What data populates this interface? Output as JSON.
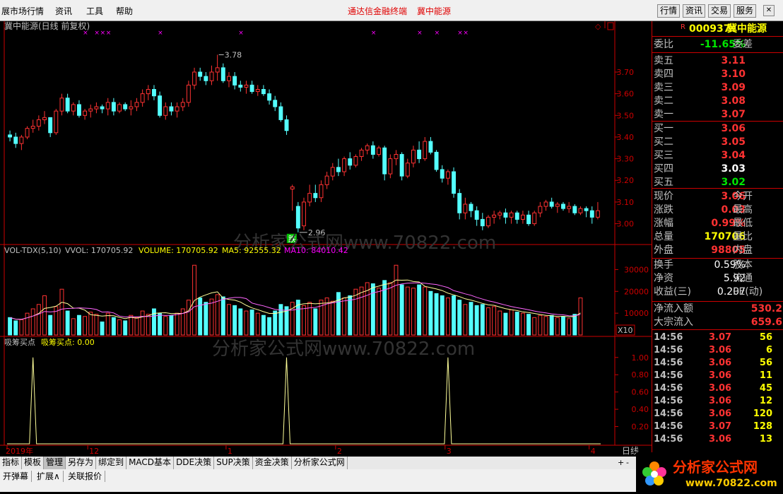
{
  "menubar": {
    "items": [
      "展市场行情",
      "资讯",
      "工具",
      "帮助"
    ],
    "center_left": "通达信金融终端",
    "center_right": "冀中能源",
    "right_buttons": [
      "行情",
      "资讯",
      "交易",
      "服务"
    ]
  },
  "chart_title": "冀中能源(日线 前复权)",
  "labels": {
    "high": "3.78",
    "low": "2.96",
    "die": "跌",
    "x10": "X10",
    "period": "日线"
  },
  "watermark": "分析家公式网www.70822.com",
  "vol_header": {
    "name": "VOL-TDX(5,10)",
    "vvol": "VVOL: 170705.92",
    "volume": "VOLUME: 170705.92",
    "ma5": "MA5: 92555.32",
    "ma10": "MA10: 84010.42"
  },
  "ind_header": {
    "name": "吸筹买点",
    "value": "吸筹买点: 0.00"
  },
  "x_axis": [
    "2019年",
    "12",
    "1",
    "2",
    "3",
    "4"
  ],
  "chart_data": [
    {
      "type": "candlestick",
      "title": "冀中能源(日线 前复权)",
      "ylim": [
        2.93,
        3.85
      ],
      "yticks": [
        3.0,
        3.1,
        3.2,
        3.3,
        3.4,
        3.5,
        3.6,
        3.7
      ],
      "ohlc": [
        [
          3.41,
          3.43,
          3.38,
          3.4
        ],
        [
          3.4,
          3.42,
          3.35,
          3.37
        ],
        [
          3.37,
          3.41,
          3.34,
          3.4
        ],
        [
          3.4,
          3.45,
          3.39,
          3.44
        ],
        [
          3.44,
          3.48,
          3.42,
          3.45
        ],
        [
          3.45,
          3.5,
          3.43,
          3.48
        ],
        [
          3.48,
          3.52,
          3.46,
          3.49
        ],
        [
          3.49,
          3.48,
          3.4,
          3.42
        ],
        [
          3.42,
          3.53,
          3.41,
          3.52
        ],
        [
          3.52,
          3.6,
          3.5,
          3.58
        ],
        [
          3.58,
          3.6,
          3.51,
          3.52
        ],
        [
          3.52,
          3.56,
          3.5,
          3.55
        ],
        [
          3.55,
          3.57,
          3.49,
          3.5
        ],
        [
          3.5,
          3.53,
          3.48,
          3.52
        ],
        [
          3.52,
          3.55,
          3.49,
          3.53
        ],
        [
          3.53,
          3.56,
          3.51,
          3.54
        ],
        [
          3.54,
          3.55,
          3.51,
          3.53
        ],
        [
          3.53,
          3.58,
          3.5,
          3.56
        ],
        [
          3.56,
          3.58,
          3.5,
          3.52
        ],
        [
          3.52,
          3.56,
          3.51,
          3.55
        ],
        [
          3.55,
          3.56,
          3.52,
          3.53
        ],
        [
          3.53,
          3.57,
          3.5,
          3.54
        ],
        [
          3.54,
          3.58,
          3.52,
          3.56
        ],
        [
          3.56,
          3.62,
          3.54,
          3.6
        ],
        [
          3.6,
          3.64,
          3.57,
          3.62
        ],
        [
          3.62,
          3.64,
          3.57,
          3.59
        ],
        [
          3.59,
          3.61,
          3.49,
          3.5
        ],
        [
          3.5,
          3.56,
          3.48,
          3.54
        ],
        [
          3.54,
          3.56,
          3.5,
          3.52
        ],
        [
          3.52,
          3.56,
          3.49,
          3.54
        ],
        [
          3.54,
          3.58,
          3.52,
          3.56
        ],
        [
          3.56,
          3.66,
          3.54,
          3.64
        ],
        [
          3.64,
          3.72,
          3.62,
          3.7
        ],
        [
          3.7,
          3.72,
          3.66,
          3.68
        ],
        [
          3.68,
          3.7,
          3.64,
          3.66
        ],
        [
          3.66,
          3.73,
          3.64,
          3.7
        ],
        [
          3.7,
          3.78,
          3.66,
          3.72
        ],
        [
          3.72,
          3.74,
          3.65,
          3.66
        ],
        [
          3.66,
          3.7,
          3.63,
          3.68
        ],
        [
          3.68,
          3.7,
          3.62,
          3.64
        ],
        [
          3.64,
          3.66,
          3.61,
          3.63
        ],
        [
          3.63,
          3.66,
          3.6,
          3.64
        ],
        [
          3.64,
          3.66,
          3.6,
          3.61
        ],
        [
          3.61,
          3.64,
          3.59,
          3.62
        ],
        [
          3.62,
          3.64,
          3.59,
          3.6
        ],
        [
          3.6,
          3.62,
          3.55,
          3.57
        ],
        [
          3.57,
          3.59,
          3.52,
          3.54
        ],
        [
          3.54,
          3.56,
          3.47,
          3.48
        ],
        [
          3.48,
          3.5,
          3.41,
          3.43
        ],
        [
          3.16,
          3.18,
          3.06,
          3.17
        ],
        [
          3.08,
          3.1,
          2.96,
          2.98
        ],
        [
          2.99,
          3.12,
          2.97,
          3.1
        ],
        [
          3.1,
          3.18,
          3.08,
          3.14
        ],
        [
          3.14,
          3.18,
          3.1,
          3.12
        ],
        [
          3.12,
          3.2,
          3.1,
          3.18
        ],
        [
          3.18,
          3.24,
          3.16,
          3.22
        ],
        [
          3.22,
          3.28,
          3.2,
          3.26
        ],
        [
          3.26,
          3.3,
          3.22,
          3.24
        ],
        [
          3.24,
          3.31,
          3.22,
          3.3
        ],
        [
          3.3,
          3.33,
          3.25,
          3.27
        ],
        [
          3.27,
          3.32,
          3.26,
          3.31
        ],
        [
          3.31,
          3.35,
          3.29,
          3.34
        ],
        [
          3.34,
          3.37,
          3.32,
          3.36
        ],
        [
          3.36,
          3.38,
          3.3,
          3.32
        ],
        [
          3.32,
          3.36,
          3.31,
          3.35
        ],
        [
          3.35,
          3.36,
          3.2,
          3.23
        ],
        [
          3.23,
          3.32,
          3.21,
          3.3
        ],
        [
          3.3,
          3.34,
          3.27,
          3.32
        ],
        [
          3.32,
          3.33,
          3.2,
          3.22
        ],
        [
          3.22,
          3.3,
          3.21,
          3.28
        ],
        [
          3.28,
          3.36,
          3.26,
          3.34
        ],
        [
          3.34,
          3.38,
          3.28,
          3.3
        ],
        [
          3.3,
          3.4,
          3.29,
          3.38
        ],
        [
          3.38,
          3.4,
          3.32,
          3.33
        ],
        [
          3.33,
          3.34,
          3.24,
          3.25
        ],
        [
          3.25,
          3.27,
          3.19,
          3.21
        ],
        [
          3.21,
          3.25,
          3.18,
          3.24
        ],
        [
          3.24,
          3.26,
          3.12,
          3.14
        ],
        [
          3.14,
          3.16,
          3.02,
          3.05
        ],
        [
          3.05,
          3.12,
          3.02,
          3.09
        ],
        [
          3.09,
          3.1,
          3.03,
          3.06
        ],
        [
          3.06,
          3.08,
          2.99,
          3.02
        ],
        [
          3.02,
          3.05,
          2.97,
          2.99
        ],
        [
          2.99,
          3.04,
          2.98,
          3.03
        ],
        [
          3.03,
          3.06,
          3.0,
          3.04
        ],
        [
          3.04,
          3.06,
          3.02,
          3.05
        ],
        [
          3.05,
          3.07,
          3.0,
          3.03
        ],
        [
          3.03,
          3.06,
          3.0,
          3.05
        ],
        [
          3.05,
          3.06,
          3.0,
          3.02
        ],
        [
          3.02,
          3.06,
          3.0,
          3.04
        ],
        [
          3.04,
          3.06,
          2.99,
          3.0
        ],
        [
          3.0,
          3.06,
          2.99,
          3.05
        ],
        [
          3.05,
          3.1,
          3.03,
          3.08
        ],
        [
          3.08,
          3.11,
          3.06,
          3.1
        ],
        [
          3.1,
          3.12,
          3.07,
          3.08
        ],
        [
          3.08,
          3.1,
          3.05,
          3.09
        ],
        [
          3.09,
          3.1,
          3.06,
          3.07
        ],
        [
          3.07,
          3.1,
          3.05,
          3.08
        ],
        [
          3.08,
          3.09,
          3.04,
          3.05
        ],
        [
          3.05,
          3.08,
          3.04,
          3.07
        ],
        [
          3.07,
          3.08,
          3.03,
          3.06
        ],
        [
          3.06,
          3.08,
          3.0,
          3.03
        ],
        [
          3.03,
          3.1,
          3.02,
          3.06
        ]
      ]
    },
    {
      "type": "bar",
      "title": "VOL-TDX(5,10)",
      "ylim": [
        0,
        35000
      ],
      "yticks": [
        10000,
        20000,
        30000
      ],
      "values": [
        8000,
        6500,
        7000,
        10000,
        12000,
        14000,
        18000,
        9000,
        13000,
        21000,
        11000,
        7500,
        9000,
        8500,
        10500,
        9500,
        6000,
        10000,
        8000,
        7000,
        6500,
        9000,
        8000,
        11000,
        9500,
        12000,
        10000,
        8500,
        9000,
        10000,
        12000,
        16000,
        32000,
        17000,
        15000,
        16500,
        18500,
        17500,
        14000,
        13500,
        12000,
        11000,
        11500,
        10000,
        9000,
        8000,
        11000,
        14000,
        13000,
        15000,
        16000,
        13500,
        15000,
        12000,
        16000,
        17000,
        15500,
        19500,
        17000,
        18000,
        21000,
        22000,
        24000,
        23500,
        21500,
        25000,
        24000,
        32000,
        23000,
        22000,
        21500,
        23000,
        22000,
        20000,
        19000,
        18000,
        17000,
        18000,
        16000,
        14000,
        15000,
        13500,
        14000,
        12500,
        13000,
        11000,
        10000,
        11500,
        10500,
        10000,
        9500,
        8000,
        9000,
        8500,
        9000,
        8000,
        8500,
        7500,
        9500,
        17000
      ],
      "series": [
        {
          "name": "MA5",
          "values": "smooth"
        },
        {
          "name": "MA10",
          "values": "smooth"
        }
      ]
    },
    {
      "type": "line",
      "title": "吸筹买点",
      "ylim": [
        0,
        1.08
      ],
      "yticks": [
        0.2,
        0.4,
        0.6,
        0.8,
        1.0
      ],
      "values": "0 except peaks of 1.00 at bars 4, 48, 76"
    }
  ],
  "quote": {
    "code": "000937",
    "name": "冀中能源",
    "weibi": {
      "label": "委比",
      "value": "-11.65%",
      "label2": "委差"
    },
    "sell": [
      {
        "label": "卖五",
        "price": "3.11"
      },
      {
        "label": "卖四",
        "price": "3.10"
      },
      {
        "label": "卖三",
        "price": "3.09"
      },
      {
        "label": "卖二",
        "price": "3.08"
      },
      {
        "label": "卖一",
        "price": "3.07"
      }
    ],
    "buy": [
      {
        "label": "买一",
        "price": "3.06"
      },
      {
        "label": "买二",
        "price": "3.05"
      },
      {
        "label": "买三",
        "price": "3.04"
      },
      {
        "label": "买四",
        "price": "3.03"
      },
      {
        "label": "买五",
        "price": "3.02"
      }
    ],
    "stats": [
      {
        "l": "现价",
        "v": "3.06",
        "r": "今开"
      },
      {
        "l": "涨跌",
        "v": "0.03",
        "r": "最高"
      },
      {
        "l": "涨幅",
        "v": "0.99%",
        "r": "最低"
      },
      {
        "l": "总量",
        "v": "170706",
        "r": "量比"
      },
      {
        "l": "外盘",
        "v": "98805",
        "r": "内盘"
      }
    ],
    "stats2": [
      {
        "l": "换手",
        "v": "0.59%",
        "r": "股本"
      },
      {
        "l": "净资",
        "v": "5.92",
        "r": "流通"
      },
      {
        "l": "收益(三)",
        "v": "0.207",
        "r": "PE(动)"
      }
    ],
    "flow": [
      {
        "l": "净流入额",
        "v": "530.2"
      },
      {
        "l": "大宗流入",
        "v": "659.6"
      }
    ],
    "ticks": [
      {
        "t": "14:56",
        "p": "3.07",
        "v": "56"
      },
      {
        "t": "14:56",
        "p": "3.06",
        "v": "6"
      },
      {
        "t": "14:56",
        "p": "3.06",
        "v": "56"
      },
      {
        "t": "14:56",
        "p": "3.06",
        "v": "11"
      },
      {
        "t": "14:56",
        "p": "3.06",
        "v": "45"
      },
      {
        "t": "14:56",
        "p": "3.06",
        "v": "12"
      },
      {
        "t": "14:56",
        "p": "3.06",
        "v": "120"
      },
      {
        "t": "14:56",
        "p": "3.07",
        "v": "128"
      },
      {
        "t": "14:56",
        "p": "3.06",
        "v": "13"
      }
    ]
  },
  "tabs": [
    "指标",
    "模板",
    "管理",
    "另存为",
    "绑定到",
    "MACD基本",
    "DDE决策",
    "SUP决策",
    "资金决策",
    "分析家公式网"
  ],
  "status": [
    "开弹幕",
    "扩展∧",
    "关联报价"
  ],
  "logo": {
    "text": "分析家公式网",
    "url": "www.70822.com"
  }
}
